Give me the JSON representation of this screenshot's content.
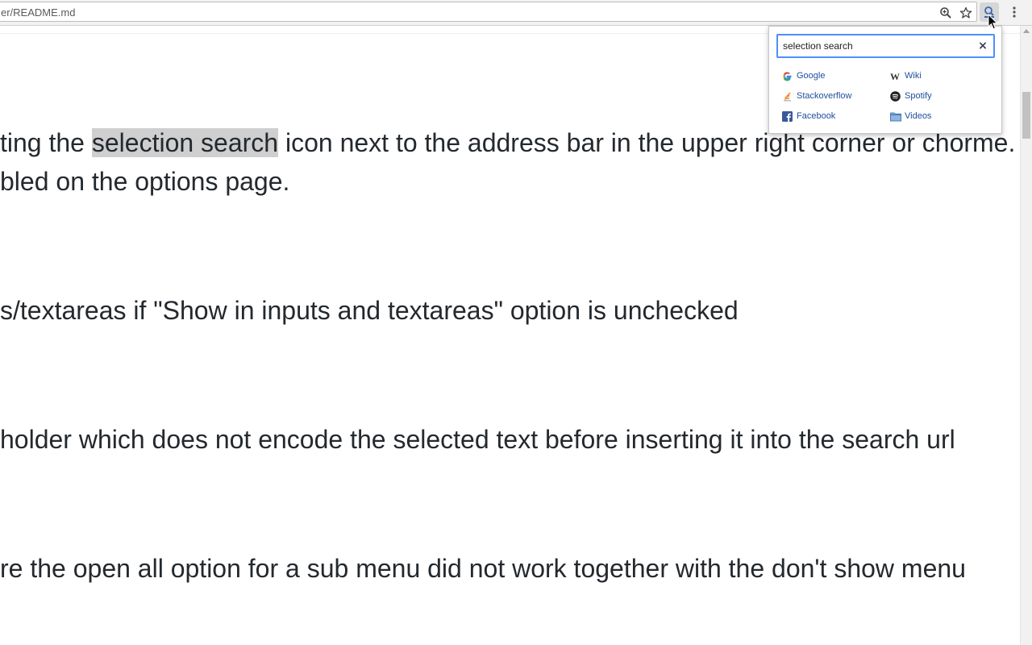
{
  "browser": {
    "url": "er/README.md"
  },
  "content": {
    "line1_pre": "ting the ",
    "line1_highlight": "selection search",
    "line1_post": " icon next to the address bar in the upper right corner or chorme.",
    "line2": "bled on the options page.",
    "line3": "s/textareas if \"Show in inputs and textareas\" option is unchecked",
    "line4": "holder which does not encode the selected text before inserting it into the search url",
    "line5": "re the open all option for a sub menu did not work together with the don't show menu"
  },
  "popup": {
    "search_value": "selection search",
    "clear_label": "×",
    "engines": [
      {
        "label": "Google",
        "icon": "google-icon"
      },
      {
        "label": "Wiki",
        "icon": "wikipedia-icon"
      },
      {
        "label": "Stackoverflow",
        "icon": "stackoverflow-icon"
      },
      {
        "label": "Spotify",
        "icon": "spotify-icon"
      },
      {
        "label": "Facebook",
        "icon": "facebook-icon"
      },
      {
        "label": "Videos",
        "icon": "folder-icon"
      }
    ]
  },
  "colors": {
    "highlight": "#cfcfcf",
    "link": "#1f4e9c",
    "focus_border": "#4d90fe",
    "text": "#24292e"
  }
}
